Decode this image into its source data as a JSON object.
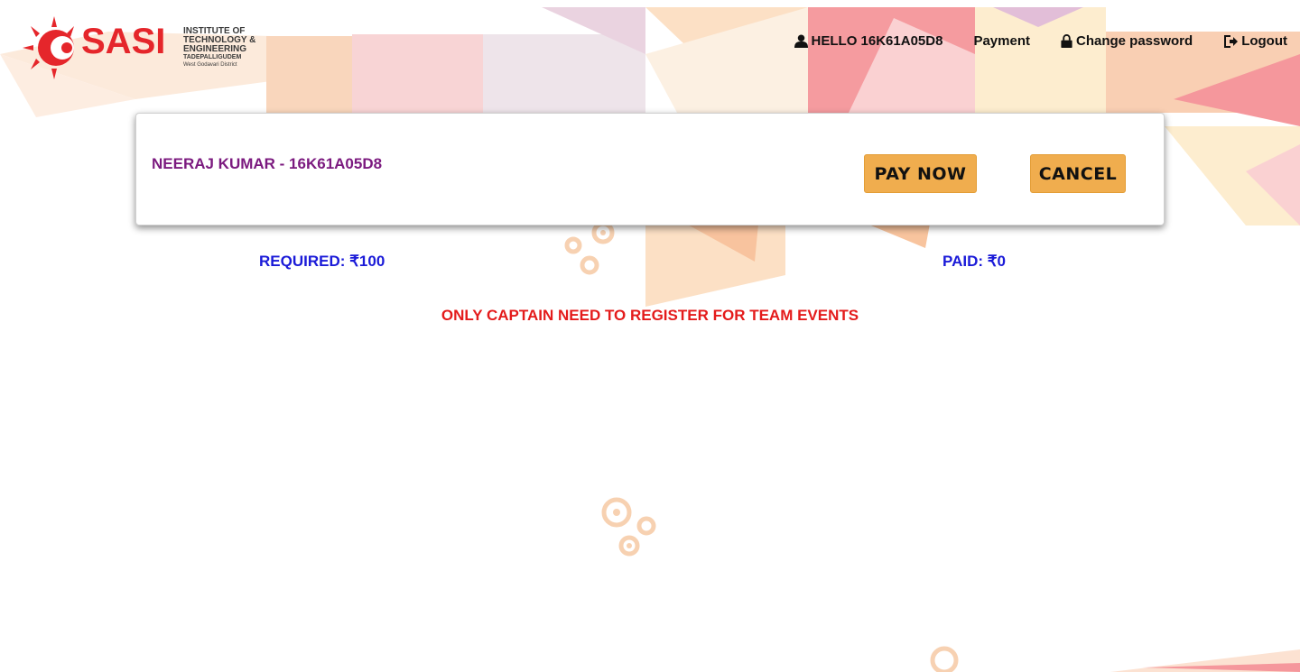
{
  "logo": {
    "brand": "SASI",
    "line1": "INSTITUTE OF",
    "line2": "TECHNOLOGY &",
    "line3": "ENGINEERING",
    "line4": "TADEPALLIGUDEM",
    "line5": "West Godavari District"
  },
  "nav": {
    "hello": "HELLO 16K61A05D8",
    "payment": "Payment",
    "change_password": "Change password",
    "logout": "Logout"
  },
  "card": {
    "student": "NEERAJ KUMAR - 16K61A05D8",
    "pay_label": "PAY NOW",
    "cancel_label": "CANCEL"
  },
  "amounts": {
    "required": "REQUIRED: ₹100",
    "paid": "PAID: ₹0"
  },
  "notice": "ONLY CAPTAIN NEED TO REGISTER FOR TEAM EVENTS",
  "icons": {
    "user": "user-icon",
    "lock": "lock-icon",
    "logout": "logout-icon"
  },
  "colors": {
    "brand_red": "#e5262b",
    "button_orange": "#f0ad4e",
    "name_purple": "#7b1a7f",
    "amount_blue": "#1a1ad8",
    "notice_red": "#e41b1b"
  }
}
